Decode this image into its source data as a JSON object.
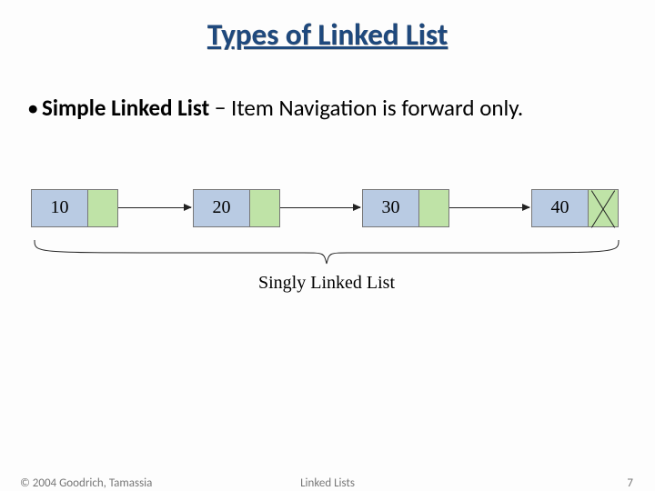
{
  "title": "Types of Linked List",
  "bullet": {
    "strong": "Simple Linked List",
    "rest": " − Item Navigation is forward only."
  },
  "diagram": {
    "nodes": [
      {
        "value": "10",
        "terminal": false
      },
      {
        "value": "20",
        "terminal": false
      },
      {
        "value": "30",
        "terminal": false
      },
      {
        "value": "40",
        "terminal": true
      }
    ],
    "caption": "Singly Linked List"
  },
  "footer": {
    "copyright": "© 2004 Goodrich, Tamassia",
    "center": "Linked Lists",
    "page": "7"
  }
}
